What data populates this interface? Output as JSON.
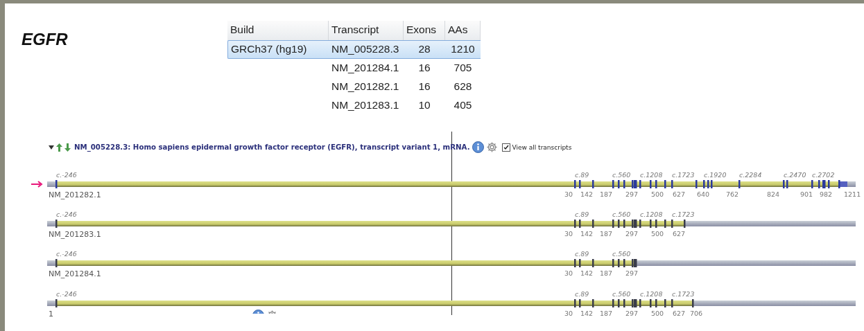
{
  "gene_title": "EGFR",
  "table": {
    "columns": [
      "Build",
      "Transcript",
      "Exons",
      "AAs"
    ],
    "rows": [
      {
        "build": "GRCh37 (hg19)",
        "transcript": "NM_005228.3",
        "exons": "28",
        "aas": "1210",
        "selected": true
      },
      {
        "transcript": "NM_201284.1",
        "exons": "16",
        "aas": "705",
        "selected": false
      },
      {
        "transcript": "NM_201282.1",
        "exons": "16",
        "aas": "628",
        "selected": false
      },
      {
        "transcript": "NM_201283.1",
        "exons": "10",
        "aas": "405",
        "selected": false
      }
    ]
  },
  "viewer": {
    "header": {
      "title": "NM_005228.3: Homo sapiens epidermal growth factor receptor (EGFR), transcript variant 1, mRNA.",
      "view_all_transcripts": {
        "label": "View all transcripts",
        "checked": true
      }
    },
    "tracks": [
      {
        "start_label": "c.-246",
        "under_label": "NM_201282.1",
        "cdna_labels": [
          "c.89",
          "c.560",
          "c.1208",
          "c.1723",
          "c.1920",
          "c.2284",
          "c.2470",
          "c.2702"
        ],
        "aa_labels": [
          "30",
          "142",
          "187",
          "297",
          "500",
          "627",
          "640",
          "762",
          "824",
          "901",
          "982",
          "1211"
        ],
        "selected": true
      },
      {
        "start_label": "c.-246",
        "under_label": "NM_201283.1",
        "cdna_labels": [
          "c.89",
          "c.560",
          "c.1208",
          "c.1723"
        ],
        "aa_labels": [
          "30",
          "142",
          "187",
          "297",
          "500",
          "627"
        ],
        "selected": false
      },
      {
        "start_label": "c.-246",
        "under_label": "NM_201284.1",
        "cdna_labels": [
          "c.89",
          "c.560"
        ],
        "aa_labels": [
          "30",
          "142",
          "187",
          "297"
        ],
        "selected": false
      },
      {
        "start_label": "c.-246",
        "under_label": "1",
        "cdna_labels": [
          "c.89",
          "c.560",
          "c.1208",
          "c.1723"
        ],
        "aa_labels": [
          "30",
          "142",
          "187",
          "297",
          "500",
          "627",
          "706"
        ],
        "selected": false
      }
    ]
  }
}
